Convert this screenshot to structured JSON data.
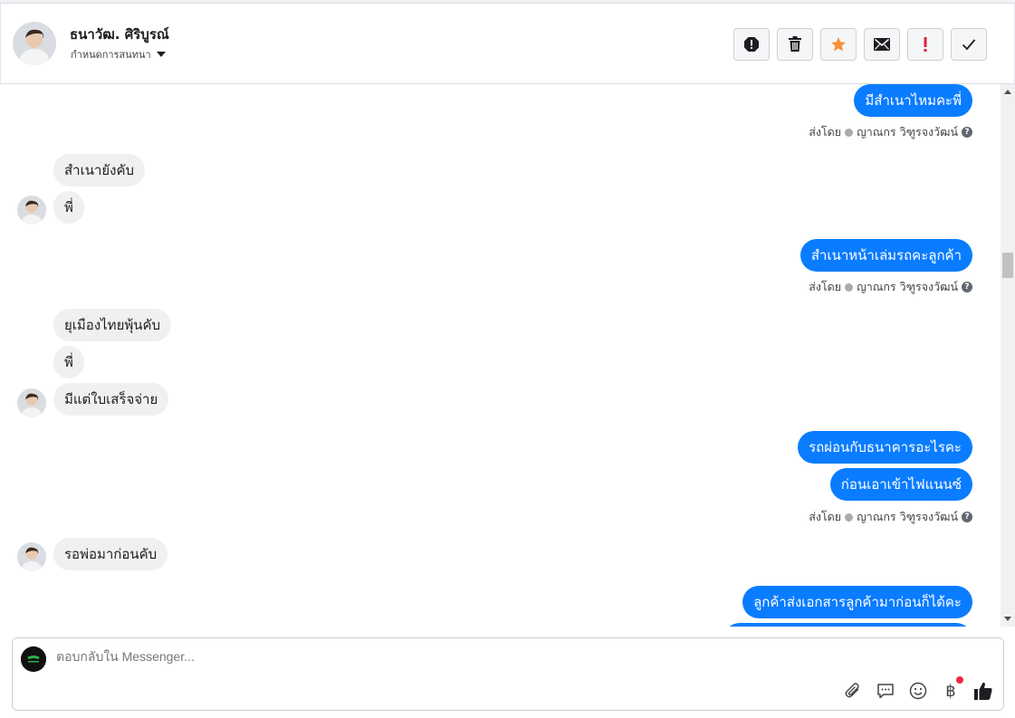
{
  "header": {
    "contact_name": "ธนาวัฒ. ศิริบูรณ์",
    "assign_label": "กำหนดการสนทนา"
  },
  "actions": [
    {
      "name": "report-icon",
      "color": "#1c1e21"
    },
    {
      "name": "trash-icon",
      "color": "#1c1e21"
    },
    {
      "name": "star-icon",
      "color": "#f7923b"
    },
    {
      "name": "mail-icon",
      "color": "#1c1e21"
    },
    {
      "name": "important-icon",
      "color": "#e41e3f"
    },
    {
      "name": "check-icon",
      "color": "#1c1e21"
    }
  ],
  "messages": {
    "m1": "มีสำเนาไหมคะพี่",
    "m2": "สำเนายังคับ",
    "m3": "พี่",
    "m4": "สำเนาหน้าเล่มรถคะลูกค้า",
    "m5": "ยุเมืองไทยพุ้นคับ",
    "m6": "พี่",
    "m7": "มีแต่ใบเสร็จจ่าย",
    "m8": "รถผ่อนกับธนาคารอะไรคะ",
    "m9": "ก่อนเอาเข้าไฟแนนซ์",
    "m10": "รอพ่อมาก่อนคับ",
    "m11": "ลูกค้าส่งเอกสารลูกค้ามาก่อนก็ได้คะ"
  },
  "sent_by": {
    "prefix": "ส่งโดย",
    "agent": "ญาณกร วิฑูรจงวัฒน์"
  },
  "composer": {
    "placeholder": "ตอบกลับใน Messenger..."
  },
  "colors": {
    "outgoing_bubble": "#0a7cff",
    "incoming_bubble": "#f0f0f0"
  }
}
